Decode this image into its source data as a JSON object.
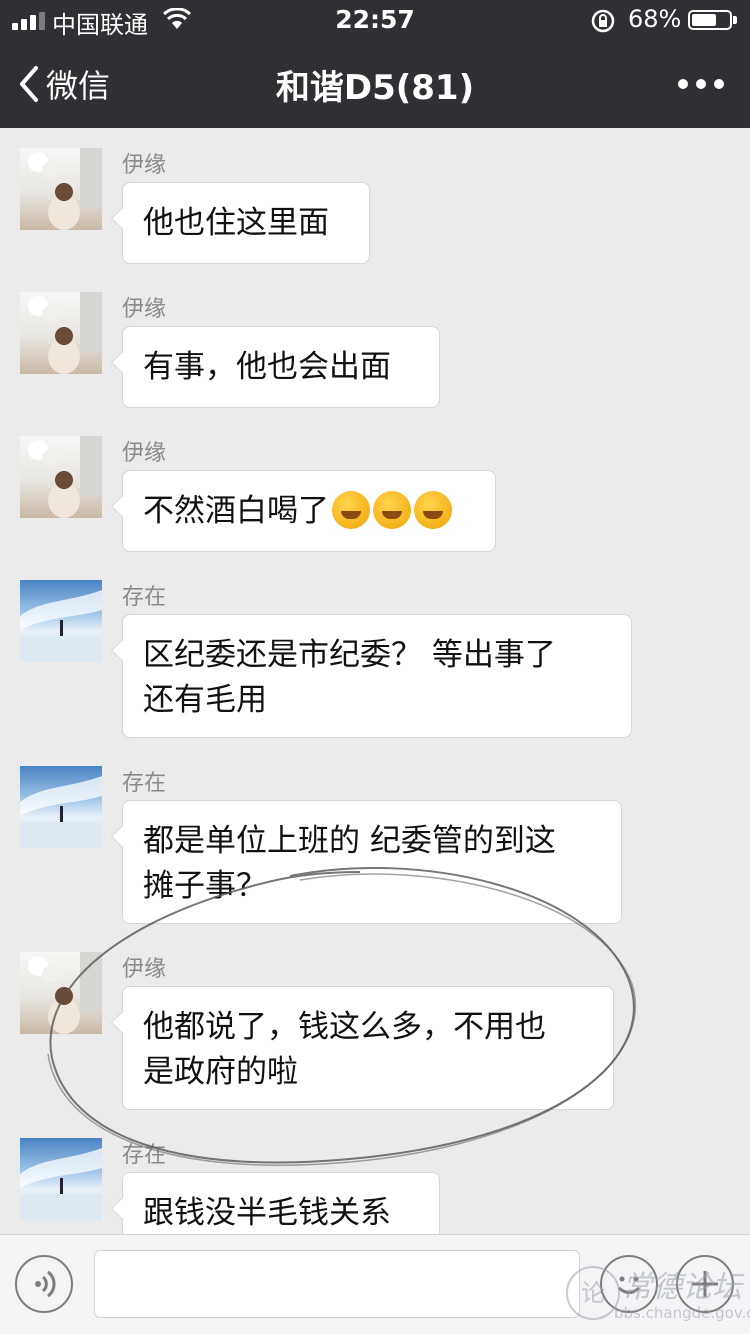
{
  "status_bar": {
    "carrier": "中国联通",
    "time": "22:57",
    "battery_percent": "68%",
    "battery_level": 0.68,
    "signal_bars_filled": 3,
    "signal_bars_total": 4
  },
  "nav": {
    "back_label": "微信",
    "title": "和谐D5(81)",
    "icons": {
      "back": "chevron-left-icon",
      "more": "more-dots-icon"
    }
  },
  "messages": [
    {
      "sender": "伊缘",
      "text": "他也住这里面",
      "avatar": "avatar-yiyuan"
    },
    {
      "sender": "伊缘",
      "text": "有事，他也会出面",
      "avatar": "avatar-yiyuan"
    },
    {
      "sender": "伊缘",
      "text": "不然酒白喝了",
      "emoji_count": 3,
      "emoji": "facepalm-laugh-emoji",
      "avatar": "avatar-yiyuan"
    },
    {
      "sender": "存在",
      "line1": "区纪委还是市纪委？ 等出事了",
      "line2": "还有毛用",
      "avatar": "avatar-cunzai"
    },
    {
      "sender": "存在",
      "line1": "都是单位上班的 纪委管的到这",
      "line2": "摊子事？",
      "avatar": "avatar-cunzai"
    },
    {
      "sender": "伊缘",
      "line1": "他都说了，钱这么多，不用也",
      "line2": "是政府的啦",
      "avatar": "avatar-yiyuan",
      "circled": true
    },
    {
      "sender": "存在",
      "text": "跟钱没半毛钱关系",
      "avatar": "avatar-cunzai"
    }
  ],
  "input_bar": {
    "value": "",
    "icons": {
      "voice": "voice-icon",
      "emoji": "emoji-icon",
      "plus": "plus-icon"
    }
  },
  "watermark": {
    "name": "常德论坛",
    "url": "bbs.changde.gov.cn"
  },
  "colors": {
    "nav_background": "#2e3033",
    "chat_background": "#ebebeb",
    "bubble_background": "#ffffff",
    "sender_name": "#8a8a8a"
  }
}
